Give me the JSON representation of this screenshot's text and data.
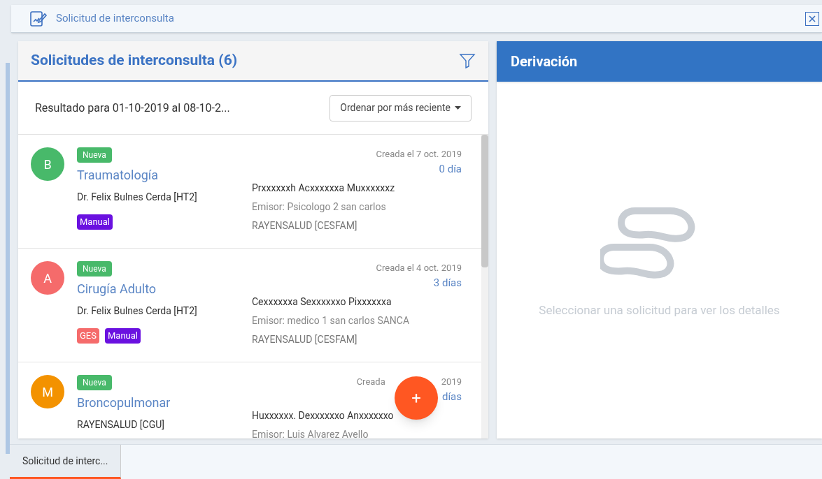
{
  "window": {
    "title": "Solicitud de interconsulta"
  },
  "list_panel": {
    "title": "Solicitudes de interconsulta (6)",
    "result_text": "Resultado para 01-10-2019 al 08-10-2...",
    "sort_button": "Ordenar por más reciente",
    "items": [
      {
        "initial": "B",
        "color": "#48b96a",
        "status": "Nueva",
        "specialty": "Traumatología",
        "doctor": "Dr. Felix Bulnes Cerda [HT2]",
        "tags": [
          {
            "label": "Manual",
            "color": "#6a11e0"
          }
        ],
        "created": "Creada el 7 oct. 2019",
        "days": "0 día",
        "patient": "Prxxxxxxh Acxxxxxxa Muxxxxxxz",
        "issuer": "Emisor: Psicologo 2 san carlos",
        "origin": "RAYENSALUD [CESFAM]"
      },
      {
        "initial": "A",
        "color": "#f56b6b",
        "status": "Nueva",
        "specialty": "Cirugía Adulto",
        "doctor": "Dr. Felix Bulnes Cerda [HT2]",
        "tags": [
          {
            "label": "GES",
            "color": "#f56b6b"
          },
          {
            "label": "Manual",
            "color": "#6a11e0"
          }
        ],
        "created": "Creada el 4 oct. 2019",
        "days": "3 días",
        "patient": "Cexxxxxxa Sexxxxxxo Pixxxxxxa",
        "issuer": "Emisor: medico 1 san carlos SANCA",
        "origin": "RAYENSALUD [CESFAM]"
      },
      {
        "initial": "M",
        "color": "#f39200",
        "status": "Nueva",
        "specialty": "Broncopulmonar",
        "doctor": "RAYENSALUD [CGU]",
        "created": "Creada",
        "created_end": "2019",
        "days": "días",
        "patient": "Huxxxxxx. Dexxxxxxo Anxxxxxxo",
        "issuer": "Emisor: Luis Alvarez Avello"
      }
    ]
  },
  "detail_panel": {
    "title": "Derivación",
    "empty_text": "Seleccionar una solicitud para ver los detalles"
  },
  "fab": {
    "label": "+"
  },
  "bottom_tabs": [
    {
      "label": "Solicitud de interc...",
      "selected": true
    }
  ]
}
